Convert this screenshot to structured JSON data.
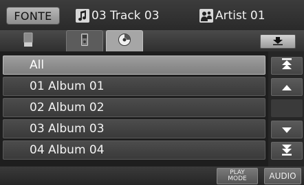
{
  "header": {
    "source_button_label": "FONTE",
    "track": {
      "icon": "music-note-icon",
      "text": "03 Track 03"
    },
    "artist": {
      "icon": "artist-icon",
      "text": "Artist 01"
    }
  },
  "tabs": [
    {
      "icon": "usb-stick-icon",
      "selected": false
    },
    {
      "icon": "ipod-icon",
      "selected": false
    },
    {
      "icon": "disc-icon",
      "selected": true
    }
  ],
  "download_button_icon": "download-arrow-icon",
  "list": {
    "items": [
      {
        "label": "All",
        "selected": true
      },
      {
        "label": "01 Album 01",
        "selected": false
      },
      {
        "label": "02 Album 02",
        "selected": false
      },
      {
        "label": "03 Album 03",
        "selected": false
      },
      {
        "label": "04 Album 04",
        "selected": false
      }
    ]
  },
  "scroll": {
    "icons": [
      "scroll-top-icon",
      "scroll-up-icon",
      "scroll-down-icon",
      "scroll-bottom-icon"
    ]
  },
  "bottom": {
    "play_mode_label": "PLAY\nMODE",
    "audio_label": "AUDIO"
  },
  "colors": {
    "background": "#1a1a1a",
    "selected_row": "#9e9e9e",
    "row": "#454545",
    "text": "#f4f4f4"
  }
}
